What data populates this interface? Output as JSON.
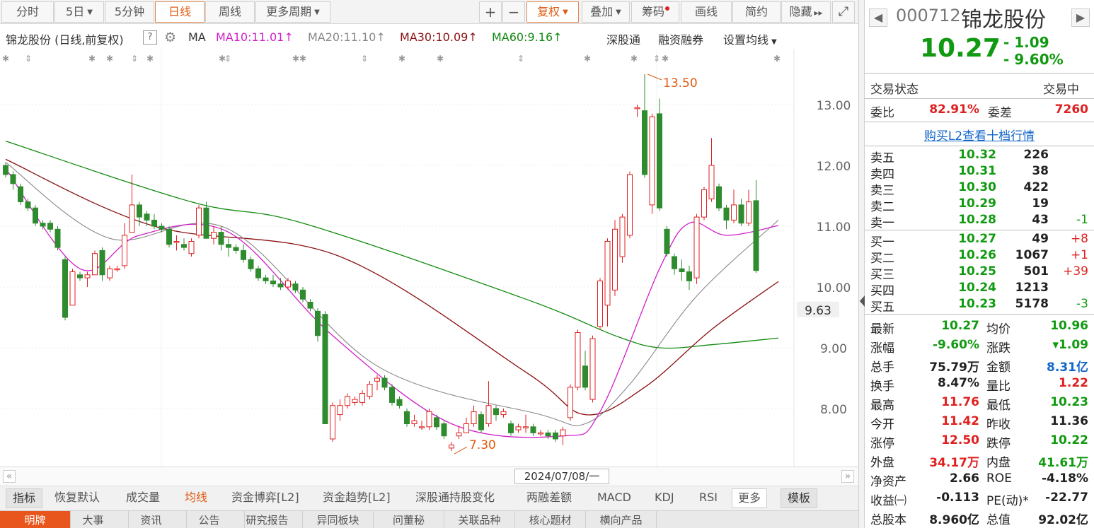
{
  "toolbar": {
    "periods": [
      "分时",
      "5日",
      "5分钟",
      "日线",
      "周线",
      "更多周期"
    ],
    "active_period": "日线",
    "zoom_in": "+",
    "zoom_out": "−",
    "fuquan": "复权",
    "overlay": "叠加",
    "chips": "筹码",
    "draw": "画线",
    "simple": "简约",
    "hide": "隐藏",
    "hide_arrows": "▸▸",
    "fullscreen_icon": "⤢"
  },
  "ma_bar": {
    "stock_label": "锦龙股份 (日线,前复权)",
    "help": "?",
    "ma": "MA",
    "ma10": "MA10:11.01",
    "ma20": "MA20:11.10",
    "ma30": "MA30:10.09",
    "ma60": "MA60:9.16",
    "arrow": "↑",
    "links": [
      "深股通",
      "融资融券",
      "设置均线"
    ],
    "ma_colors": {
      "ma10": "#d020c8",
      "ma20": "#888888",
      "ma30": "#8a1010",
      "ma60": "#118a11"
    }
  },
  "chart_data": {
    "type": "candlestick",
    "y_ticks": [
      "13.00",
      "12.00",
      "11.00",
      "10.00",
      "9.00",
      "8.00"
    ],
    "ylim": [
      7.0,
      13.6
    ],
    "current_price_tag": "9.63",
    "high_annotation": "13.50",
    "low_annotation": "7.30",
    "date_label": "2024/07/08/一",
    "candles": [
      {
        "o": 12.0,
        "c": 11.85,
        "h": 12.05,
        "l": 11.8
      },
      {
        "o": 11.85,
        "c": 11.7,
        "h": 11.9,
        "l": 11.6
      },
      {
        "o": 11.65,
        "c": 11.4,
        "h": 11.7,
        "l": 11.35
      },
      {
        "o": 11.4,
        "c": 11.3,
        "h": 11.45,
        "l": 11.25
      },
      {
        "o": 11.3,
        "c": 11.05,
        "h": 11.35,
        "l": 11.0
      },
      {
        "o": 11.05,
        "c": 11.0,
        "h": 11.1,
        "l": 10.95
      },
      {
        "o": 11.05,
        "c": 10.95,
        "h": 11.1,
        "l": 10.9
      },
      {
        "o": 10.95,
        "c": 10.65,
        "h": 11.0,
        "l": 10.6
      },
      {
        "o": 10.45,
        "c": 9.5,
        "h": 10.5,
        "l": 9.45
      },
      {
        "o": 9.7,
        "c": 10.25,
        "h": 10.3,
        "l": 9.7
      },
      {
        "o": 10.2,
        "c": 10.15,
        "h": 10.25,
        "l": 10.1
      },
      {
        "o": 10.15,
        "c": 10.2,
        "h": 10.25,
        "l": 10.0
      },
      {
        "o": 10.2,
        "c": 10.55,
        "h": 10.6,
        "l": 10.2
      },
      {
        "o": 10.6,
        "c": 10.2,
        "h": 10.65,
        "l": 10.1
      },
      {
        "o": 10.15,
        "c": 10.3,
        "h": 10.35,
        "l": 10.1
      },
      {
        "o": 10.3,
        "c": 10.3,
        "h": 10.35,
        "l": 10.25
      },
      {
        "o": 10.35,
        "c": 10.85,
        "h": 11.05,
        "l": 10.3
      },
      {
        "o": 10.9,
        "c": 11.35,
        "h": 11.85,
        "l": 10.9
      },
      {
        "o": 11.35,
        "c": 11.15,
        "h": 11.4,
        "l": 11.0
      },
      {
        "o": 11.2,
        "c": 11.1,
        "h": 11.25,
        "l": 11.0
      },
      {
        "o": 11.1,
        "c": 11.0,
        "h": 11.2,
        "l": 10.95
      },
      {
        "o": 11.0,
        "c": 10.95,
        "h": 11.05,
        "l": 10.9
      },
      {
        "o": 10.95,
        "c": 10.7,
        "h": 11.0,
        "l": 10.65
      },
      {
        "o": 10.75,
        "c": 10.75,
        "h": 10.85,
        "l": 10.6
      },
      {
        "o": 10.7,
        "c": 10.65,
        "h": 10.8,
        "l": 10.6
      },
      {
        "o": 10.55,
        "c": 10.75,
        "h": 10.8,
        "l": 10.5
      },
      {
        "o": 10.85,
        "c": 11.3,
        "h": 11.35,
        "l": 10.8
      },
      {
        "o": 11.3,
        "c": 10.8,
        "h": 11.4,
        "l": 10.8
      },
      {
        "o": 10.8,
        "c": 10.9,
        "h": 11.0,
        "l": 10.7
      },
      {
        "o": 10.9,
        "c": 10.7,
        "h": 11.0,
        "l": 10.6
      },
      {
        "o": 10.7,
        "c": 10.65,
        "h": 10.8,
        "l": 10.5
      },
      {
        "o": 10.65,
        "c": 10.6,
        "h": 10.7,
        "l": 10.55
      },
      {
        "o": 10.6,
        "c": 10.45,
        "h": 10.7,
        "l": 10.4
      },
      {
        "o": 10.45,
        "c": 10.3,
        "h": 10.5,
        "l": 10.25
      },
      {
        "o": 10.3,
        "c": 10.15,
        "h": 10.35,
        "l": 10.1
      },
      {
        "o": 10.15,
        "c": 10.1,
        "h": 10.2,
        "l": 10.05
      },
      {
        "o": 10.1,
        "c": 10.05,
        "h": 10.2,
        "l": 10.0
      },
      {
        "o": 10.05,
        "c": 10.0,
        "h": 10.15,
        "l": 9.95
      },
      {
        "o": 10.0,
        "c": 10.1,
        "h": 10.15,
        "l": 9.95
      },
      {
        "o": 10.05,
        "c": 9.95,
        "h": 10.1,
        "l": 9.9
      },
      {
        "o": 9.95,
        "c": 9.8,
        "h": 10.0,
        "l": 9.75
      },
      {
        "o": 9.75,
        "c": 9.65,
        "h": 9.8,
        "l": 9.6
      },
      {
        "o": 9.6,
        "c": 9.2,
        "h": 9.65,
        "l": 9.1
      },
      {
        "o": 9.55,
        "c": 7.75,
        "h": 9.6,
        "l": 7.75
      },
      {
        "o": 7.5,
        "c": 8.05,
        "h": 8.1,
        "l": 7.45
      },
      {
        "o": 7.9,
        "c": 8.05,
        "h": 8.15,
        "l": 7.8
      },
      {
        "o": 8.05,
        "c": 8.2,
        "h": 8.25,
        "l": 8.0
      },
      {
        "o": 8.1,
        "c": 8.15,
        "h": 8.2,
        "l": 8.05
      },
      {
        "o": 8.1,
        "c": 8.25,
        "h": 8.3,
        "l": 8.05
      },
      {
        "o": 8.2,
        "c": 8.4,
        "h": 8.45,
        "l": 8.15
      },
      {
        "o": 8.45,
        "c": 8.5,
        "h": 8.55,
        "l": 8.3
      },
      {
        "o": 8.5,
        "c": 8.35,
        "h": 8.55,
        "l": 8.3
      },
      {
        "o": 8.35,
        "c": 8.1,
        "h": 8.4,
        "l": 8.05
      },
      {
        "o": 8.15,
        "c": 8.05,
        "h": 8.2,
        "l": 8.0
      },
      {
        "o": 7.95,
        "c": 7.75,
        "h": 8.0,
        "l": 7.7
      },
      {
        "o": 7.75,
        "c": 7.8,
        "h": 7.9,
        "l": 7.7
      },
      {
        "o": 7.7,
        "c": 7.7,
        "h": 7.8,
        "l": 7.65
      },
      {
        "o": 7.7,
        "c": 7.95,
        "h": 8.0,
        "l": 7.65
      },
      {
        "o": 7.85,
        "c": 7.7,
        "h": 7.9,
        "l": 7.65
      },
      {
        "o": 7.75,
        "c": 7.55,
        "h": 7.8,
        "l": 7.5
      },
      {
        "o": 7.35,
        "c": 7.4,
        "h": 7.45,
        "l": 7.3
      },
      {
        "o": 7.55,
        "c": 7.6,
        "h": 7.7,
        "l": 7.5
      },
      {
        "o": 7.6,
        "c": 7.75,
        "h": 7.85,
        "l": 7.6
      },
      {
        "o": 7.75,
        "c": 7.95,
        "h": 8.05,
        "l": 7.7
      },
      {
        "o": 7.9,
        "c": 7.65,
        "h": 7.95,
        "l": 7.6
      },
      {
        "o": 7.75,
        "c": 8.05,
        "h": 8.45,
        "l": 7.7
      },
      {
        "o": 8.0,
        "c": 7.9,
        "h": 8.05,
        "l": 7.8
      },
      {
        "o": 7.9,
        "c": 7.95,
        "h": 8.0,
        "l": 7.85
      },
      {
        "o": 7.75,
        "c": 7.6,
        "h": 7.8,
        "l": 7.55
      },
      {
        "o": 7.65,
        "c": 7.7,
        "h": 7.75,
        "l": 7.6
      },
      {
        "o": 7.7,
        "c": 7.7,
        "h": 7.9,
        "l": 7.6
      },
      {
        "o": 7.7,
        "c": 7.6,
        "h": 7.75,
        "l": 7.55
      },
      {
        "o": 7.6,
        "c": 7.6,
        "h": 7.65,
        "l": 7.55
      },
      {
        "o": 7.6,
        "c": 7.55,
        "h": 7.65,
        "l": 7.5
      },
      {
        "o": 7.6,
        "c": 7.5,
        "h": 7.65,
        "l": 7.45
      },
      {
        "o": 7.55,
        "c": 7.65,
        "h": 7.7,
        "l": 7.4
      },
      {
        "o": 7.85,
        "c": 8.35,
        "h": 8.4,
        "l": 7.8
      },
      {
        "o": 8.35,
        "c": 9.25,
        "h": 9.3,
        "l": 8.3
      },
      {
        "o": 8.7,
        "c": 8.35,
        "h": 8.95,
        "l": 8.3
      },
      {
        "o": 8.15,
        "c": 9.15,
        "h": 9.2,
        "l": 8.1
      },
      {
        "o": 9.35,
        "c": 10.1,
        "h": 10.15,
        "l": 9.3
      },
      {
        "o": 9.7,
        "c": 10.75,
        "h": 10.8,
        "l": 9.35
      },
      {
        "o": 9.95,
        "c": 10.95,
        "h": 11.1,
        "l": 9.85
      },
      {
        "o": 10.5,
        "c": 11.15,
        "h": 11.2,
        "l": 10.4
      },
      {
        "o": 10.85,
        "c": 11.85,
        "h": 11.9,
        "l": 10.8
      },
      {
        "o": 12.95,
        "c": 12.95,
        "h": 13.0,
        "l": 12.8
      },
      {
        "o": 12.9,
        "c": 11.85,
        "h": 13.5,
        "l": 11.8
      },
      {
        "o": 11.35,
        "c": 12.8,
        "h": 12.85,
        "l": 11.2
      },
      {
        "o": 12.85,
        "c": 11.3,
        "h": 13.1,
        "l": 11.25
      },
      {
        "o": 10.95,
        "c": 10.55,
        "h": 11.0,
        "l": 10.5
      },
      {
        "o": 10.5,
        "c": 10.3,
        "h": 10.55,
        "l": 10.2
      },
      {
        "o": 10.3,
        "c": 10.25,
        "h": 10.45,
        "l": 10.1
      },
      {
        "o": 10.25,
        "c": 10.1,
        "h": 10.35,
        "l": 9.95
      },
      {
        "o": 10.15,
        "c": 11.15,
        "h": 11.2,
        "l": 10.05
      },
      {
        "o": 11.15,
        "c": 11.6,
        "h": 11.65,
        "l": 11.1
      },
      {
        "o": 11.45,
        "c": 12.0,
        "h": 12.45,
        "l": 11.4
      },
      {
        "o": 11.65,
        "c": 11.3,
        "h": 11.7,
        "l": 11.25
      },
      {
        "o": 11.3,
        "c": 11.1,
        "h": 11.35,
        "l": 10.95
      },
      {
        "o": 11.1,
        "c": 11.35,
        "h": 11.6,
        "l": 11.05
      },
      {
        "o": 11.35,
        "c": 11.05,
        "h": 11.45,
        "l": 11.0
      },
      {
        "o": 11.05,
        "c": 11.4,
        "h": 11.6,
        "l": 11.0
      },
      {
        "o": 11.42,
        "c": 10.27,
        "h": 11.76,
        "l": 10.23
      }
    ],
    "ma10_anchors": [
      [
        0,
        11.95
      ],
      [
        10,
        10.3
      ],
      [
        18,
        10.85
      ],
      [
        30,
        10.9
      ],
      [
        44,
        9.2
      ],
      [
        60,
        7.75
      ],
      [
        75,
        7.55
      ],
      [
        80,
        7.95
      ],
      [
        88,
        10.3
      ],
      [
        92,
        11.05
      ],
      [
        97,
        10.85
      ],
      [
        104,
        11.01
      ]
    ],
    "ma20_anchors": [
      [
        0,
        12.05
      ],
      [
        14,
        10.8
      ],
      [
        30,
        10.95
      ],
      [
        50,
        8.7
      ],
      [
        72,
        7.9
      ],
      [
        78,
        7.75
      ],
      [
        84,
        8.4
      ],
      [
        93,
        9.85
      ],
      [
        104,
        11.1
      ]
    ],
    "ma30_anchors": [
      [
        0,
        12.1
      ],
      [
        20,
        11.0
      ],
      [
        45,
        10.5
      ],
      [
        70,
        8.6
      ],
      [
        78,
        7.9
      ],
      [
        86,
        8.35
      ],
      [
        95,
        9.3
      ],
      [
        104,
        10.09
      ]
    ],
    "ma60_anchors": [
      [
        0,
        12.4
      ],
      [
        25,
        11.4
      ],
      [
        40,
        11.05
      ],
      [
        70,
        9.8
      ],
      [
        82,
        9.2
      ],
      [
        88,
        9.0
      ],
      [
        95,
        9.05
      ],
      [
        104,
        9.16
      ]
    ]
  },
  "indicator_tabs": [
    "指标",
    "恢复默认",
    "成交量",
    "均线",
    "资金博弈[L2]",
    "资金趋势[L2]",
    "深股通持股变化",
    "两融差额",
    "MACD",
    "KDJ",
    "RSI",
    "更多",
    "模板"
  ],
  "active_indicator": "均线",
  "bottom_tabs": [
    "明牌",
    "大事",
    "资讯",
    "公告",
    "研究报告",
    "异同板块",
    "问董秘",
    "关联品种",
    "核心题材",
    "横向产品"
  ],
  "quote": {
    "code": "000712",
    "name": "锦龙股份",
    "price": "10.27",
    "change": "- 1.09",
    "change_pct": "- 9.60%",
    "trade_status_label": "交易状态",
    "trade_status": "交易中",
    "weibi_label": "委比",
    "weibi": "82.91%",
    "weicha_label": "委差",
    "weicha": "7260",
    "l2_link": "购买L2查看十档行情",
    "asks": [
      {
        "label": "卖五",
        "price": "10.32",
        "vol": "226",
        "chg": ""
      },
      {
        "label": "卖四",
        "price": "10.31",
        "vol": "38",
        "chg": ""
      },
      {
        "label": "卖三",
        "price": "10.30",
        "vol": "422",
        "chg": ""
      },
      {
        "label": "卖二",
        "price": "10.29",
        "vol": "19",
        "chg": ""
      },
      {
        "label": "卖一",
        "price": "10.28",
        "vol": "43",
        "chg": "-1"
      }
    ],
    "bids": [
      {
        "label": "买一",
        "price": "10.27",
        "vol": "49",
        "chg": "+8"
      },
      {
        "label": "买二",
        "price": "10.26",
        "vol": "1067",
        "chg": "+1"
      },
      {
        "label": "买三",
        "price": "10.25",
        "vol": "501",
        "chg": "+39"
      },
      {
        "label": "买四",
        "price": "10.24",
        "vol": "1213",
        "chg": ""
      },
      {
        "label": "买五",
        "price": "10.23",
        "vol": "5178",
        "chg": "-3"
      }
    ],
    "stats": [
      {
        "l1": "最新",
        "v1": "10.27",
        "c1": "green",
        "l2": "均价",
        "v2": "10.96",
        "c2": "green"
      },
      {
        "l1": "涨幅",
        "v1": "-9.60%",
        "c1": "green",
        "l2": "涨跌",
        "v2": "▾1.09",
        "c2": "green"
      },
      {
        "l1": "总手",
        "v1": "75.79万",
        "c1": "dark",
        "l2": "金额",
        "v2": "8.31亿",
        "c2": "blue"
      },
      {
        "l1": "换手",
        "v1": "8.47%",
        "c1": "dark",
        "l2": "量比",
        "v2": "1.22",
        "c2": "red"
      },
      {
        "l1": "最高",
        "v1": "11.76",
        "c1": "red",
        "l2": "最低",
        "v2": "10.23",
        "c2": "green"
      },
      {
        "l1": "今开",
        "v1": "11.42",
        "c1": "red",
        "l2": "昨收",
        "v2": "11.36",
        "c2": "dark"
      },
      {
        "l1": "涨停",
        "v1": "12.50",
        "c1": "red",
        "l2": "跌停",
        "v2": "10.22",
        "c2": "green"
      },
      {
        "l1": "外盘",
        "v1": "34.17万",
        "c1": "red",
        "l2": "内盘",
        "v2": "41.61万",
        "c2": "green"
      },
      {
        "l1": "净资产",
        "v1": "2.66",
        "c1": "dark",
        "l2": "ROE",
        "v2": "-4.18%",
        "c2": "dark"
      },
      {
        "l1": "收益㈠",
        "v1": "-0.113",
        "c1": "dark",
        "l2": "PE(动)*",
        "v2": "-22.77",
        "c2": "dark"
      },
      {
        "l1": "总股本",
        "v1": "8.960亿",
        "c1": "dark",
        "l2": "总值",
        "v2": "92.02亿",
        "c2": "dark"
      }
    ]
  },
  "colors": {
    "up": "#e02020",
    "down": "#2e8b2e",
    "accent": "#e05a10",
    "link": "#1366c9"
  }
}
